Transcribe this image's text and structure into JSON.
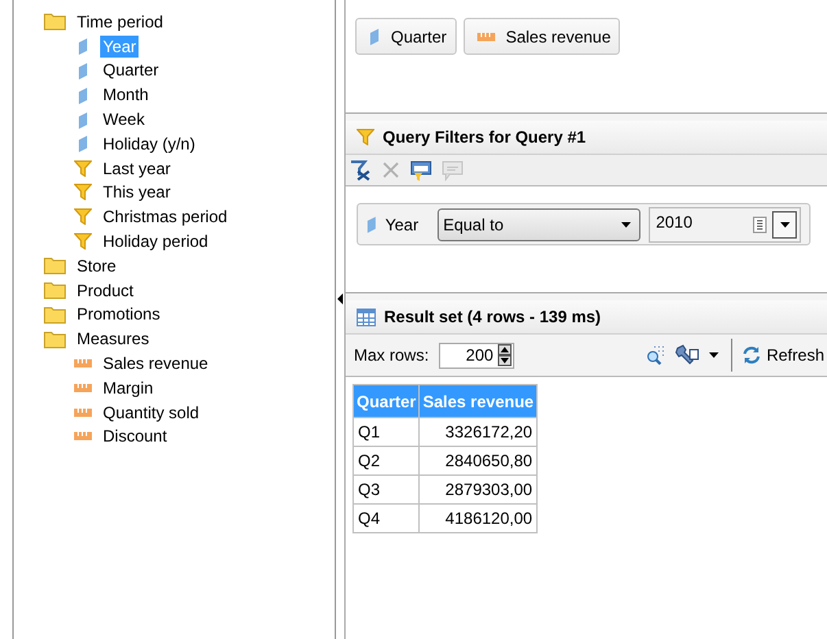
{
  "tree": [
    {
      "label": "Time period",
      "kind": "folder",
      "children": [
        {
          "label": "Year",
          "kind": "dimension",
          "selected": true
        },
        {
          "label": "Quarter",
          "kind": "dimension",
          "selected": false
        },
        {
          "label": "Month",
          "kind": "dimension",
          "selected": false
        },
        {
          "label": "Week",
          "kind": "dimension",
          "selected": false
        },
        {
          "label": "Holiday (y/n)",
          "kind": "dimension",
          "selected": false
        },
        {
          "label": "Last year",
          "kind": "filter",
          "selected": false
        },
        {
          "label": "This year",
          "kind": "filter",
          "selected": false
        },
        {
          "label": "Christmas period",
          "kind": "filter",
          "selected": false
        },
        {
          "label": "Holiday period",
          "kind": "filter",
          "selected": false
        }
      ]
    },
    {
      "label": "Store",
      "kind": "folder"
    },
    {
      "label": "Product",
      "kind": "folder"
    },
    {
      "label": "Promotions",
      "kind": "folder"
    },
    {
      "label": "Measures",
      "kind": "folder",
      "children": [
        {
          "label": "Sales revenue",
          "kind": "measure",
          "selected": false
        },
        {
          "label": "Margin",
          "kind": "measure",
          "selected": false
        },
        {
          "label": "Quantity sold",
          "kind": "measure",
          "selected": false
        },
        {
          "label": "Discount",
          "kind": "measure",
          "selected": false
        }
      ]
    }
  ],
  "result_objects": [
    {
      "label": "Quarter",
      "kind": "dimension"
    },
    {
      "label": "Sales revenue",
      "kind": "measure"
    }
  ],
  "filters_panel": {
    "title": "Query Filters for Query #1",
    "toolbar": [
      {
        "kind": "clear",
        "disabled": false
      },
      {
        "kind": "delete",
        "disabled": true
      },
      {
        "kind": "filter-edit",
        "disabled": false
      },
      {
        "kind": "prompt",
        "disabled": true
      }
    ],
    "filters": [
      {
        "object": "Year",
        "kind": "dimension",
        "operator": "Equal to",
        "value": "2010"
      }
    ]
  },
  "results_panel": {
    "title": "Result set (4 rows - 139 ms)",
    "max_rows_label": "Max rows:",
    "max_rows": "200",
    "refresh_label": "Refresh",
    "columns": [
      "Quarter",
      "Sales revenue"
    ],
    "rows": [
      [
        "Q1",
        "3326172,20"
      ],
      [
        "Q2",
        "2840650,80"
      ],
      [
        "Q3",
        "2879303,00"
      ],
      [
        "Q4",
        "4186120,00"
      ]
    ]
  }
}
